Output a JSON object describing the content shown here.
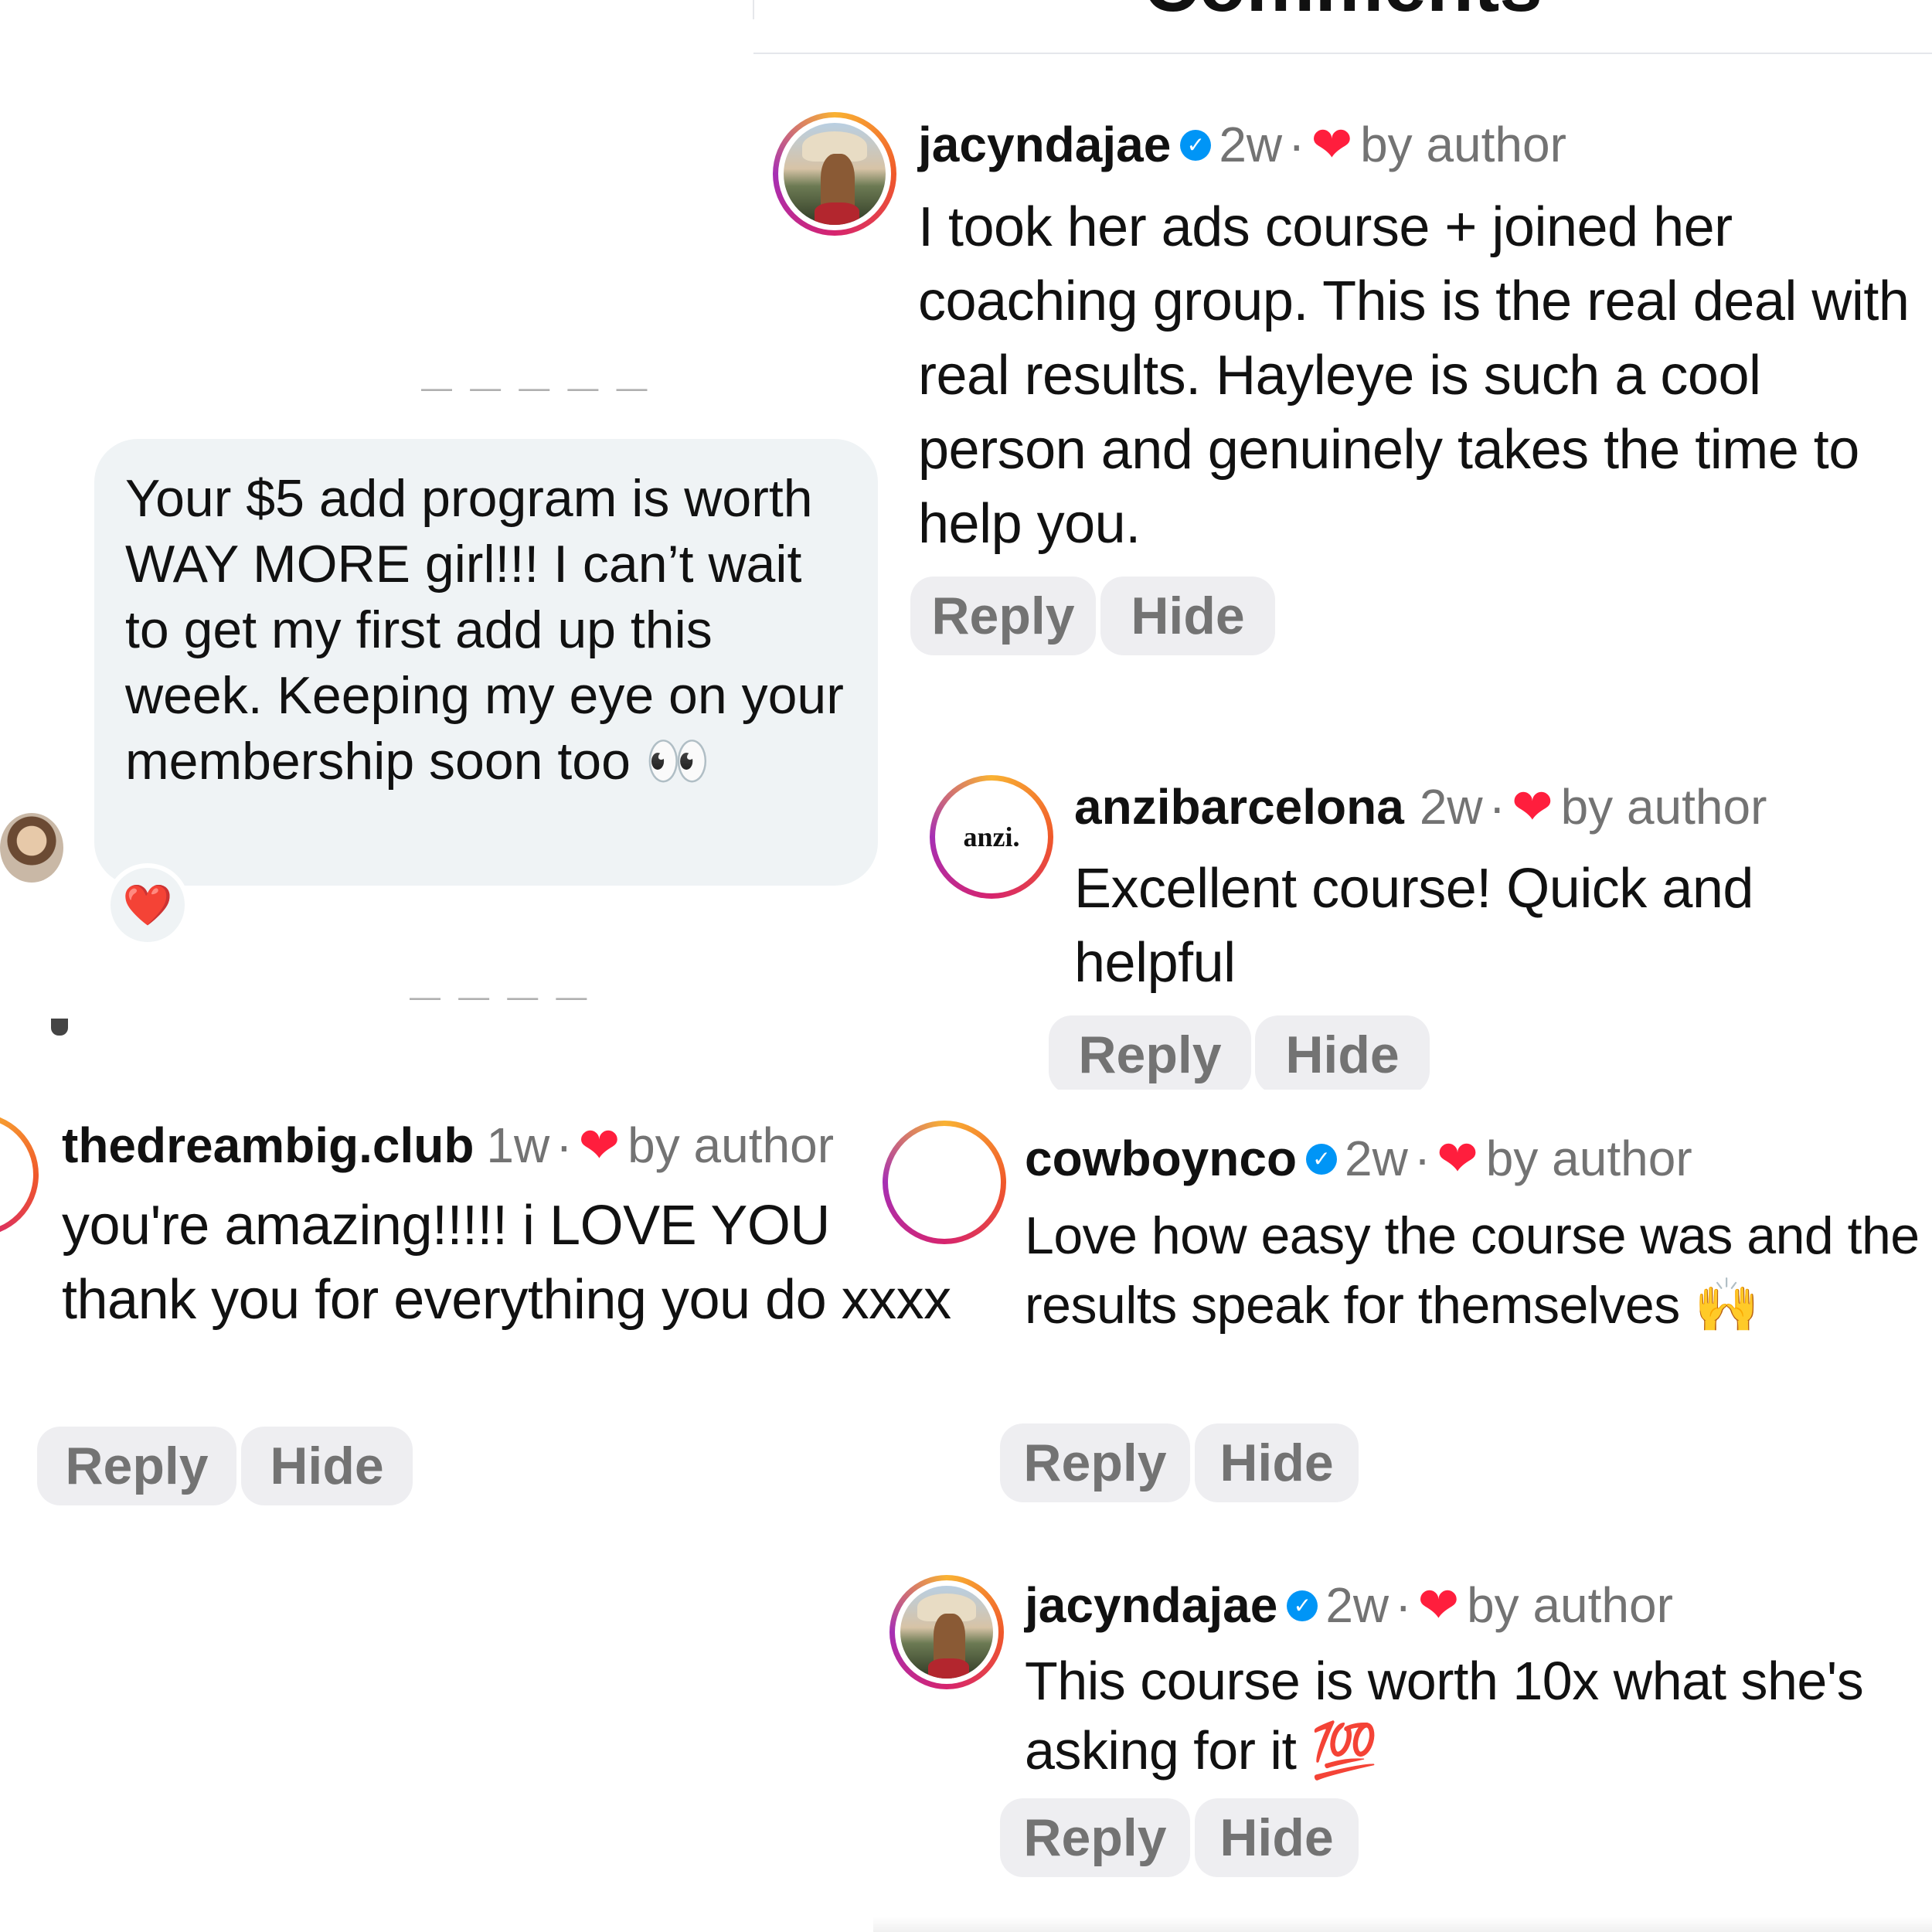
{
  "header": {
    "title": "Comments"
  },
  "dm": {
    "message": "Your $5 add program is worth WAY MORE girl!!! I can’t wait to get my first add up this week. Keeping my eye on your membership soon too 👀",
    "reaction": "❤️"
  },
  "buttons": {
    "reply": "Reply",
    "hide": "Hide"
  },
  "comments": [
    {
      "username": "jacyndajae",
      "verified": true,
      "time": "2w",
      "liked_by": "by author",
      "text": "I took her ads course + joined her coaching group. This is the real deal with real results. Hayleye is such a cool person and genuinely takes the time to help you."
    },
    {
      "username": "anzibarcelona",
      "verified": false,
      "time": "2w",
      "liked_by": "by author",
      "avatar_text": "anzi.",
      "text": "Excellent course! Quick and helpful"
    },
    {
      "username": "thedreambig.club",
      "verified": false,
      "time": "1w",
      "liked_by": "by author",
      "text": "you're amazing!!!!! i LOVE YOU thank you for everything you do xxxx"
    },
    {
      "username": "cowboynco",
      "verified": true,
      "time": "2w",
      "liked_by": "by author",
      "text": "Love how easy the course was and the results speak for themselves 🙌"
    },
    {
      "username": "jacyndajae",
      "verified": true,
      "time": "2w",
      "liked_by": "by author",
      "text": "This course is worth 10x what she's asking for it 💯"
    }
  ],
  "colors": {
    "heart": "#ff1e3d",
    "verified": "#0095f6",
    "meta_gray": "#737373",
    "button_bg": "#eeeef1",
    "bubble_bg": "#eff3f5"
  }
}
